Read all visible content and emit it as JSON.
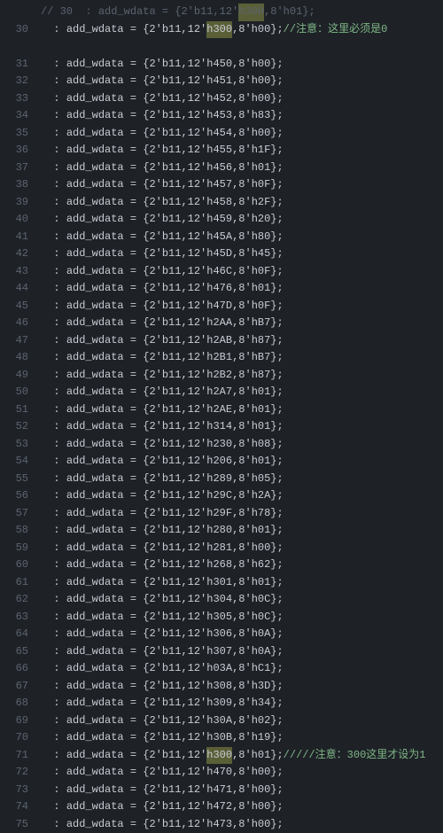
{
  "comment_line": {
    "prefix": "// 30",
    "sep": "  : ",
    "var": "add_wdata",
    "part1": " = {2'b11,12'",
    "hl": "h300",
    "part2": ",8'h01};"
  },
  "line_30": {
    "num": "30",
    "var": "add_wdata",
    "part1": " = {2'b11,12'",
    "hl": "h300",
    "part2": ",8'h00};",
    "comment": "//注意：这里必须是0"
  },
  "line_71": {
    "num": "71",
    "var": "add_wdata",
    "part1": " = {2'b11,12'",
    "hl": "h300",
    "part2": ",8'h01};",
    "comment": "/////注意：300这里才设为1"
  },
  "lines": [
    {
      "num": "31",
      "hex1": "h450",
      "hex2": "h00"
    },
    {
      "num": "32",
      "hex1": "h451",
      "hex2": "h00"
    },
    {
      "num": "33",
      "hex1": "h452",
      "hex2": "h00"
    },
    {
      "num": "34",
      "hex1": "h453",
      "hex2": "h83"
    },
    {
      "num": "35",
      "hex1": "h454",
      "hex2": "h00"
    },
    {
      "num": "36",
      "hex1": "h455",
      "hex2": "h1F"
    },
    {
      "num": "37",
      "hex1": "h456",
      "hex2": "h01"
    },
    {
      "num": "38",
      "hex1": "h457",
      "hex2": "h0F"
    },
    {
      "num": "39",
      "hex1": "h458",
      "hex2": "h2F"
    },
    {
      "num": "40",
      "hex1": "h459",
      "hex2": "h20"
    },
    {
      "num": "41",
      "hex1": "h45A",
      "hex2": "h80"
    },
    {
      "num": "42",
      "hex1": "h45D",
      "hex2": "h45"
    },
    {
      "num": "43",
      "hex1": "h46C",
      "hex2": "h0F"
    },
    {
      "num": "44",
      "hex1": "h476",
      "hex2": "h01"
    },
    {
      "num": "45",
      "hex1": "h47D",
      "hex2": "h0F"
    },
    {
      "num": "46",
      "hex1": "h2AA",
      "hex2": "hB7"
    },
    {
      "num": "47",
      "hex1": "h2AB",
      "hex2": "h87"
    },
    {
      "num": "48",
      "hex1": "h2B1",
      "hex2": "hB7"
    },
    {
      "num": "49",
      "hex1": "h2B2",
      "hex2": "h87"
    },
    {
      "num": "50",
      "hex1": "h2A7",
      "hex2": "h01"
    },
    {
      "num": "51",
      "hex1": "h2AE",
      "hex2": "h01"
    },
    {
      "num": "52",
      "hex1": "h314",
      "hex2": "h01"
    },
    {
      "num": "53",
      "hex1": "h230",
      "hex2": "h08"
    },
    {
      "num": "54",
      "hex1": "h206",
      "hex2": "h01"
    },
    {
      "num": "55",
      "hex1": "h289",
      "hex2": "h05"
    },
    {
      "num": "56",
      "hex1": "h29C",
      "hex2": "h2A"
    },
    {
      "num": "57",
      "hex1": "h29F",
      "hex2": "h78"
    },
    {
      "num": "58",
      "hex1": "h280",
      "hex2": "h01"
    },
    {
      "num": "59",
      "hex1": "h281",
      "hex2": "h00"
    },
    {
      "num": "60",
      "hex1": "h268",
      "hex2": "h62"
    },
    {
      "num": "61",
      "hex1": "h301",
      "hex2": "h01"
    },
    {
      "num": "62",
      "hex1": "h304",
      "hex2": "h0C"
    },
    {
      "num": "63",
      "hex1": "h305",
      "hex2": "h0C"
    },
    {
      "num": "64",
      "hex1": "h306",
      "hex2": "h0A"
    },
    {
      "num": "65",
      "hex1": "h307",
      "hex2": "h0A"
    },
    {
      "num": "66",
      "hex1": "h03A",
      "hex2": "hC1"
    },
    {
      "num": "67",
      "hex1": "h308",
      "hex2": "h3D"
    },
    {
      "num": "68",
      "hex1": "h309",
      "hex2": "h34"
    },
    {
      "num": "69",
      "hex1": "h30A",
      "hex2": "h02"
    },
    {
      "num": "70",
      "hex1": "h30B",
      "hex2": "h19"
    }
  ],
  "lines_after": [
    {
      "num": "72",
      "hex1": "h470",
      "hex2": "h00"
    },
    {
      "num": "73",
      "hex1": "h471",
      "hex2": "h00"
    },
    {
      "num": "74",
      "hex1": "h472",
      "hex2": "h00"
    },
    {
      "num": "75",
      "hex1": "h473",
      "hex2": "h00"
    }
  ],
  "common": {
    "sep": "  : ",
    "var": "add_wdata",
    "assign_open": " = {",
    "prefix1": "2'b11",
    "comma": ",",
    "prefix2": "12'",
    "prefix3": "8'",
    "close": "};"
  }
}
